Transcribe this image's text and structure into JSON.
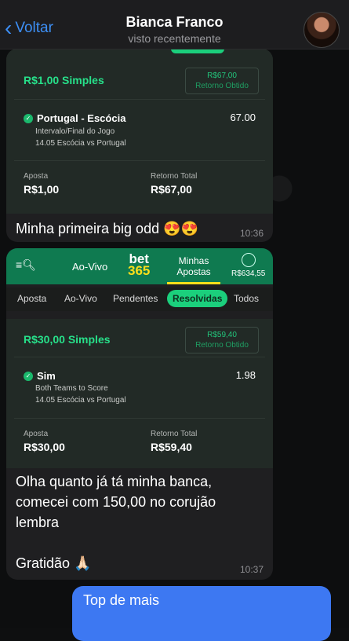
{
  "header": {
    "back_label": "Voltar",
    "contact_name": "Bianca Franco",
    "status": "visto recentemente"
  },
  "message1": {
    "bet_type": "R$1,00 Simples",
    "return_value": "R$67,00",
    "return_label": "Retorno Obtido",
    "selection": "Portugal - Escócia",
    "market": "Intervalo/Final do Jogo",
    "event": "14.05 Escócia vs Portugal",
    "odd": "67.00",
    "stake_label": "Aposta",
    "stake_value": "R$1,00",
    "total_return_label": "Retorno Total",
    "total_return_value": "R$67,00",
    "caption": "Minha primeira big odd 😍😍",
    "time": "10:36"
  },
  "message2": {
    "app": {
      "menu_icon": "menu-search-icon",
      "nav_live": "Ao-Vivo",
      "logo_top": "bet",
      "logo_bottom": "365",
      "nav_my_bets_1": "Minhas",
      "nav_my_bets_2": "Apostas",
      "balance": "R$634,55"
    },
    "tabs": [
      "Aposta",
      "Ao-Vivo",
      "Pendentes",
      "Resolvidas",
      "Todos"
    ],
    "bet_type": "R$30,00 Simples",
    "return_value": "R$59,40",
    "return_label": "Retorno Obtido",
    "selection": "Sim",
    "market": "Both Teams to Score",
    "event": "14.05 Escócia vs Portugal",
    "odd": "1.98",
    "stake_label": "Aposta",
    "stake_value": "R$30,00",
    "total_return_label": "Retorno Total",
    "total_return_value": "R$59,40",
    "caption_line1": "Olha quanto já tá minha banca,",
    "caption_line2": "comecei com 150,00 no corujão",
    "caption_line3": "lembra",
    "caption_line4": "Gratidão 🙏🏻",
    "time": "10:37"
  },
  "message3": {
    "text": "Top de mais"
  },
  "colors": {
    "accent_green": "#1bcf7c",
    "bet365_green": "#0f7a50",
    "ios_blue": "#3d8ff5",
    "outgoing_bubble": "#3d78f2"
  }
}
